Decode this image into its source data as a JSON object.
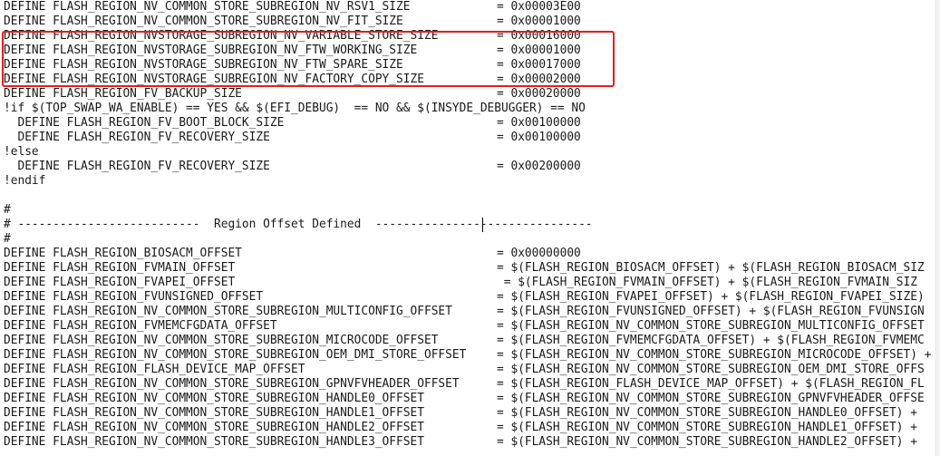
{
  "highlight_color": "#e0201e",
  "lines": [
    {
      "lhs": "DEFINE FLASH_REGION_NV_COMMON_STORE_SUBREGION_NV_RSV1_SIZE",
      "rhs": "= 0x00003E00"
    },
    {
      "lhs": "DEFINE FLASH_REGION_NV_COMMON_STORE_SUBREGION_NV_FIT_SIZE",
      "rhs": "= 0x00001000"
    },
    {
      "lhs": "DEFINE FLASH_REGION_NVSTORAGE_SUBREGION_NV_VARIABLE_STORE_SIZE",
      "rhs": "= 0x00016000"
    },
    {
      "lhs": "DEFINE FLASH_REGION_NVSTORAGE_SUBREGION_NV_FTW_WORKING_SIZE",
      "rhs": "= 0x00001000"
    },
    {
      "lhs": "DEFINE FLASH_REGION_NVSTORAGE_SUBREGION_NV_FTW_SPARE_SIZE",
      "rhs": "= 0x00017000"
    },
    {
      "lhs": "DEFINE FLASH_REGION_NVSTORAGE_SUBREGION_NV_FACTORY_COPY_SIZE",
      "rhs": "= 0x00002000"
    },
    {
      "lhs": "DEFINE FLASH_REGION_FV_BACKUP_SIZE",
      "rhs": "= 0x00020000"
    },
    {
      "lhs": "!if $(TOP_SWAP_WA_ENABLE) == YES && $(EFI_DEBUG)  == NO && $(INSYDE_DEBUGGER) == NO",
      "rhs": ""
    },
    {
      "lhs": "  DEFINE FLASH_REGION_FV_BOOT_BLOCK_SIZE",
      "rhs": "= 0x00100000"
    },
    {
      "lhs": "  DEFINE FLASH_REGION_FV_RECOVERY_SIZE",
      "rhs": "= 0x00100000"
    },
    {
      "lhs": "!else",
      "rhs": ""
    },
    {
      "lhs": "  DEFINE FLASH_REGION_FV_RECOVERY_SIZE",
      "rhs": "= 0x00200000"
    },
    {
      "lhs": "!endif",
      "rhs": ""
    },
    {
      "lhs": "",
      "rhs": ""
    },
    {
      "lhs": "#",
      "rhs": ""
    },
    {
      "lhs": "# --------------------------  Region Offset Defined  -------------------------------",
      "rhs": ""
    },
    {
      "lhs": "#",
      "rhs": ""
    },
    {
      "lhs": "DEFINE FLASH_REGION_BIOSACM_OFFSET",
      "rhs": "= 0x00000000"
    },
    {
      "lhs": "DEFINE FLASH_REGION_FVMAIN_OFFSET",
      "rhs": "= $(FLASH_REGION_BIOSACM_OFFSET) + $(FLASH_REGION_BIOSACM_SIZ"
    },
    {
      "lhs": "DEFINE FLASH_REGION_FVAPEI_OFFSET",
      "rhs": " = $(FLASH_REGION_FVMAIN_OFFSET) + $(FLASH_REGION_FVMAIN_SIZ"
    },
    {
      "lhs": "DEFINE FLASH_REGION_FVUNSIGNED_OFFSET",
      "rhs": "= $(FLASH_REGION_FVAPEI_OFFSET) + $(FLASH_REGION_FVAPEI_SIZE)"
    },
    {
      "lhs": "DEFINE FLASH_REGION_NV_COMMON_STORE_SUBREGION_MULTICONFIG_OFFSET",
      "rhs": "= $(FLASH_REGION_FVUNSIGNED_OFFSET) + $(FLASH_REGION_FVUNSIGN"
    },
    {
      "lhs": "DEFINE FLASH_REGION_FVMEMCFGDATA_OFFSET",
      "rhs": "= $(FLASH_REGION_NV_COMMON_STORE_SUBREGION_MULTICONFIG_OFFSET"
    },
    {
      "lhs": "DEFINE FLASH_REGION_NV_COMMON_STORE_SUBREGION_MICROCODE_OFFSET",
      "rhs": "= $(FLASH_REGION_FVMEMCFGDATA_OFFSET) + $(FLASH_REGION_FVMEMC"
    },
    {
      "lhs": "DEFINE FLASH_REGION_NV_COMMON_STORE_SUBREGION_OEM_DMI_STORE_OFFSET",
      "rhs": "= $(FLASH_REGION_NV_COMMON_STORE_SUBREGION_MICROCODE_OFFSET) +"
    },
    {
      "lhs": "DEFINE FLASH_REGION_FLASH_DEVICE_MAP_OFFSET",
      "rhs": "= $(FLASH_REGION_NV_COMMON_STORE_SUBREGION_OEM_DMI_STORE_OFFS"
    },
    {
      "lhs": "DEFINE FLASH_REGION_NV_COMMON_STORE_SUBREGION_GPNVFVHEADER_OFFSET",
      "rhs": "= $(FLASH_REGION_FLASH_DEVICE_MAP_OFFSET) + $(FLASH_REGION_FL"
    },
    {
      "lhs": "DEFINE FLASH_REGION_NV_COMMON_STORE_SUBREGION_HANDLE0_OFFSET",
      "rhs": "= $(FLASH_REGION_NV_COMMON_STORE_SUBREGION_GPNVFVHEADER_OFFSE"
    },
    {
      "lhs": "DEFINE FLASH_REGION_NV_COMMON_STORE_SUBREGION_HANDLE1_OFFSET",
      "rhs": "= $(FLASH_REGION_NV_COMMON_STORE_SUBREGION_HANDLE0_OFFSET) +"
    },
    {
      "lhs": "DEFINE FLASH_REGION_NV_COMMON_STORE_SUBREGION_HANDLE2_OFFSET",
      "rhs": "= $(FLASH_REGION_NV_COMMON_STORE_SUBREGION_HANDLE1_OFFSET) +"
    },
    {
      "lhs": "DEFINE FLASH_REGION_NV_COMMON_STORE_SUBREGION_HANDLE3_OFFSET",
      "rhs": "= $(FLASH_REGION_NV_COMMON_STORE_SUBREGION_HANDLE2_OFFSET) +"
    }
  ]
}
